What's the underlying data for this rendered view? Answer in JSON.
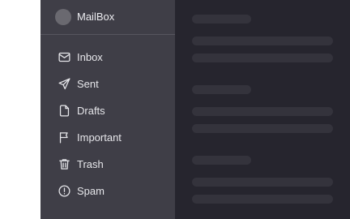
{
  "app": {
    "name": "MailBox"
  },
  "sidebar": {
    "items": [
      {
        "label": "Inbox",
        "icon": "mail-icon"
      },
      {
        "label": "Sent",
        "icon": "send-icon"
      },
      {
        "label": "Drafts",
        "icon": "document-icon"
      },
      {
        "label": "Important",
        "icon": "flag-icon"
      },
      {
        "label": "Trash",
        "icon": "trash-icon"
      },
      {
        "label": "Spam",
        "icon": "alert-circle-icon"
      }
    ]
  },
  "colors": {
    "sidebar_bg": "#3f3e47",
    "content_bg": "#26252e",
    "skeleton": "#34333c",
    "text": "#e6e6ea"
  }
}
